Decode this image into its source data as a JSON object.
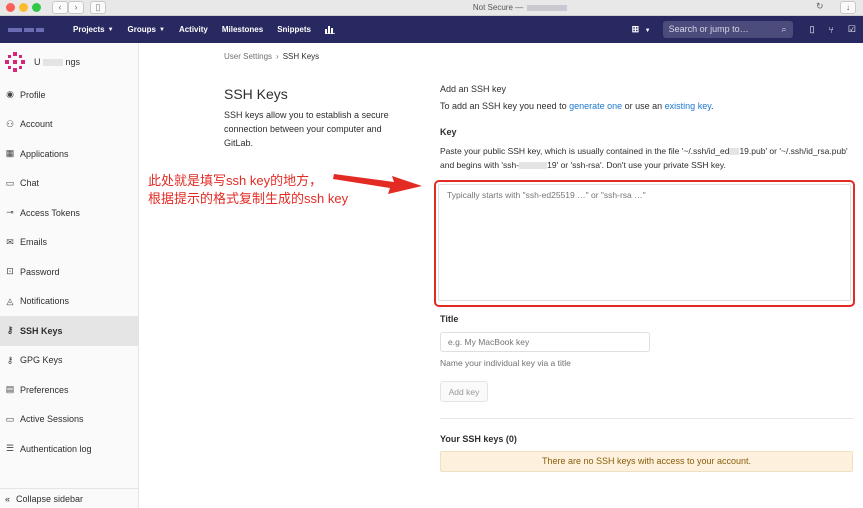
{
  "browser": {
    "url_text": "Not Secure —",
    "colors": {
      "close": "#fc5f57",
      "minimize": "#fdbc2e",
      "maximize": "#33c748"
    }
  },
  "header": {
    "nav": [
      {
        "label": "Projects",
        "has_caret": true
      },
      {
        "label": "Groups",
        "has_caret": true
      },
      {
        "label": "Activity",
        "has_caret": false
      },
      {
        "label": "Milestones",
        "has_caret": false
      },
      {
        "label": "Snippets",
        "has_caret": false
      }
    ],
    "search_placeholder": "Search or jump to…",
    "background": "#292961"
  },
  "sidebar": {
    "user_name_start": "U",
    "user_name_end": "ngs",
    "items": [
      {
        "label": "Profile",
        "icon": "profile-icon",
        "active": false
      },
      {
        "label": "Account",
        "icon": "account-icon",
        "active": false
      },
      {
        "label": "Applications",
        "icon": "applications-icon",
        "active": false
      },
      {
        "label": "Chat",
        "icon": "chat-icon",
        "active": false
      },
      {
        "label": "Access Tokens",
        "icon": "access-tokens-icon",
        "active": false
      },
      {
        "label": "Emails",
        "icon": "emails-icon",
        "active": false
      },
      {
        "label": "Password",
        "icon": "password-icon",
        "active": false
      },
      {
        "label": "Notifications",
        "icon": "notifications-icon",
        "active": false
      },
      {
        "label": "SSH Keys",
        "icon": "ssh-key-icon",
        "active": true
      },
      {
        "label": "GPG Keys",
        "icon": "gpg-key-icon",
        "active": false
      },
      {
        "label": "Preferences",
        "icon": "preferences-icon",
        "active": false
      },
      {
        "label": "Active Sessions",
        "icon": "sessions-icon",
        "active": false
      },
      {
        "label": "Authentication log",
        "icon": "auth-log-icon",
        "active": false
      }
    ],
    "collapse_label": "Collapse sidebar"
  },
  "breadcrumb": {
    "parent": "User Settings",
    "current": "SSH Keys"
  },
  "page": {
    "title": "SSH Keys",
    "description": "SSH keys allow you to establish a secure connection between your computer and GitLab."
  },
  "form": {
    "add_title": "Add an SSH key",
    "add_desc_prefix": "To add an SSH key you need to ",
    "generate_link": "generate one",
    "add_desc_middle": " or use an ",
    "existing_link": "existing key",
    "add_desc_suffix": ".",
    "key_label": "Key",
    "key_help_1": "Paste your public SSH key, which is usually contained in the file '~/.ssh/id_ed",
    "key_help_2": "19.pub' or '~/.ssh/id_rsa.pub' and begins with 'ssh-",
    "key_help_3": "19' or 'ssh-rsa'. Don't use your private SSH key.",
    "key_placeholder": "Typically starts with \"ssh-ed25519 …\" or \"ssh-rsa …\"",
    "title_label": "Title",
    "title_placeholder": "e.g. My MacBook key",
    "title_help": "Name your individual key via a title",
    "add_key_button": "Add key"
  },
  "keys_list": {
    "heading": "Your SSH keys (0)",
    "empty_message": "There are no SSH keys with access to your account.",
    "alert_bg": "#fdf1dd"
  },
  "annotation": {
    "line1": "此处就是填写ssh key的地方，",
    "line2": "根据提示的格式复制生成的ssh key",
    "color": "#e32b24"
  }
}
